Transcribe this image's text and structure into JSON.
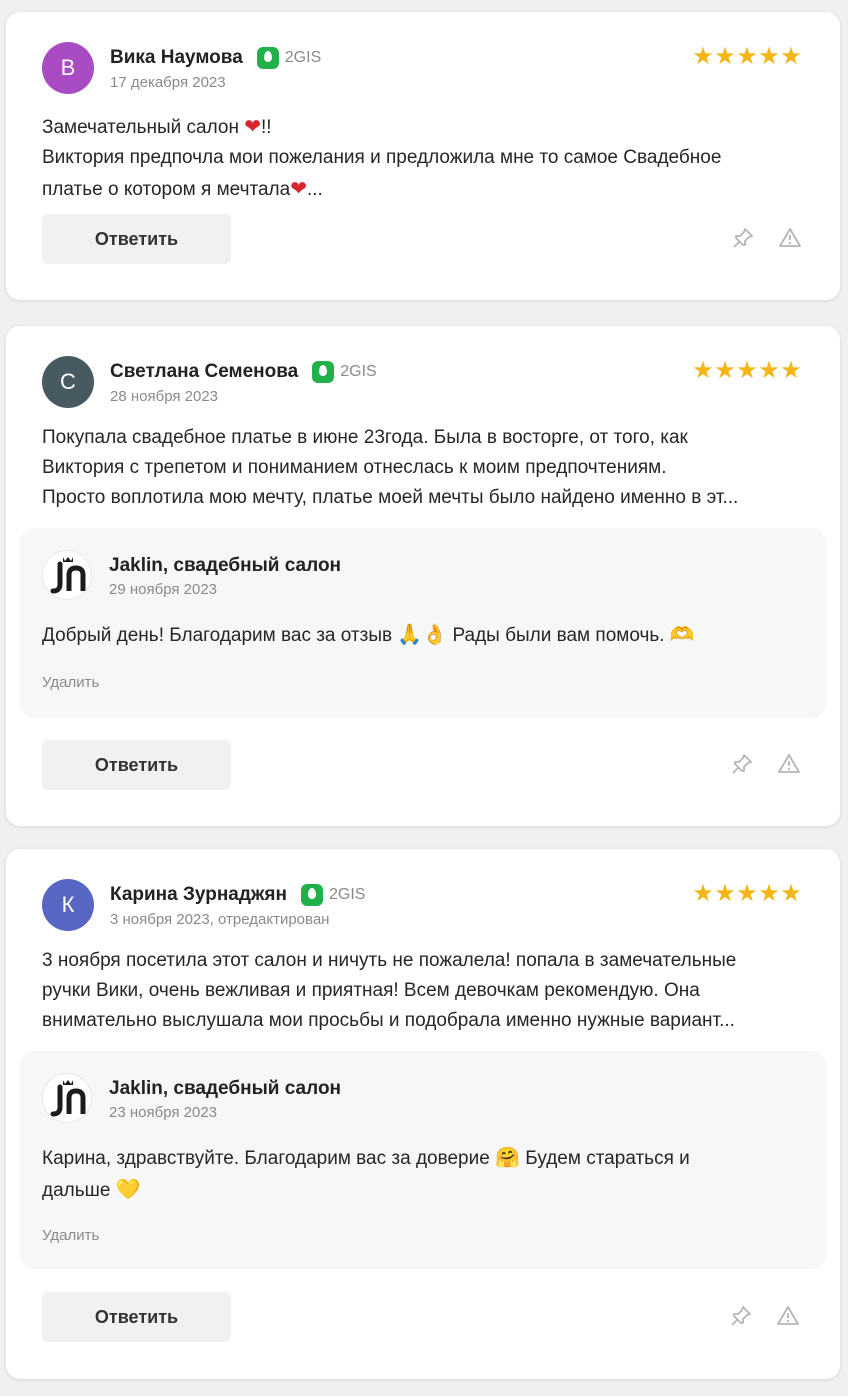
{
  "theme": {
    "star_color": "#f5b515",
    "source_color": "#21b14b",
    "page_background": "#eef0f2"
  },
  "reply_button_label": "Ответить",
  "delete_label": "Удалить",
  "icons": {
    "pin": "pin-icon",
    "report": "warning-triangle-icon",
    "star": "star-icon",
    "source": "2gis-icon"
  },
  "reviews": [
    {
      "avatar_letter": "В",
      "avatar_color": "#a94bc2",
      "author": "Вика Наумова",
      "source": "2GIS",
      "date": "17 декабря 2023",
      "rating": 5,
      "text_lines": [
        {
          "before": "Замечательный салон ",
          "emoji": "❤",
          "after": "!!"
        },
        {
          "before": "Виктория предпочла мои пожелания и предложила мне то самое Свадебное",
          "emoji": "",
          "after": ""
        },
        {
          "before": "платье о котором я мечтала",
          "emoji": "❤",
          "after": "..."
        }
      ]
    },
    {
      "avatar_letter": "С",
      "avatar_color": "#475a61",
      "author": "Светлана Семенова",
      "source": "2GIS",
      "date": "28 ноября 2023",
      "rating": 5,
      "text_lines": [
        {
          "before": "Покупала свадебное платье в июне 23года. Была в восторге, от того, как",
          "emoji": "",
          "after": ""
        },
        {
          "before": "Виктория с трепетом и пониманием отнеслась к моим предпочтениям.",
          "emoji": "",
          "after": ""
        },
        {
          "before": "Просто воплотила мою мечту, платье моей мечты было найдено именно в эт...",
          "emoji": "",
          "after": ""
        }
      ],
      "reply": {
        "author": "Jaklin, свадебный салон",
        "date": "29 ноября 2023",
        "lines": [
          {
            "before": "Добрый день! Благодарим вас за отзыв ",
            "emoji": "🙏👌",
            "after": " Рады были вам помочь. ",
            "emoji2": "🫶"
          }
        ]
      }
    },
    {
      "avatar_letter": "К",
      "avatar_color": "#5866c3",
      "author": "Карина Зурнаджян",
      "source": "2GIS",
      "date": "3 ноября 2023, отредактирован",
      "rating": 5,
      "text_lines": [
        {
          "before": "3 ноября посетила этот салон и ничуть не пожалела! попала в замечательные",
          "emoji": "",
          "after": ""
        },
        {
          "before": "ручки Вики, очень вежливая и приятная! Всем девочкам рекомендую. Она",
          "emoji": "",
          "after": ""
        },
        {
          "before": "внимательно выслушала мои просьбы и подобрала именно нужные вариант...",
          "emoji": "",
          "after": ""
        }
      ],
      "reply": {
        "author": "Jaklin, свадебный салон",
        "date": "23 ноября 2023",
        "lines": [
          {
            "before": "Карина, здравствуйте. Благодарим вас за доверие ",
            "emoji": "🤗",
            "after": " Будем стараться и",
            "emoji2": ""
          },
          {
            "before": "дальше ",
            "emoji": "💛",
            "after": "",
            "emoji2": ""
          }
        ]
      }
    }
  ]
}
